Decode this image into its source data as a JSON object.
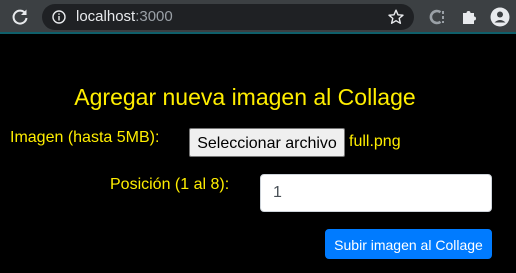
{
  "browser": {
    "url_host": "localhost",
    "url_port": ":3000",
    "icons": {
      "reload": "reload-icon",
      "info": "info-icon",
      "bookmark": "star-icon",
      "extension_1": "extension-c-icon",
      "extension_2": "puzzle-icon",
      "profile": "profile-icon"
    }
  },
  "form": {
    "title": "Agregar nueva imagen al Collage",
    "image_label": "Imagen (hasta 5MB):",
    "file_button_label": "Seleccionar archivo",
    "file_name": "full.png",
    "position_label": "Posición (1 al 8):",
    "position_value": "1",
    "submit_label": "Subir imagen al Collage"
  },
  "colors": {
    "page_background": "#000000",
    "text_accent": "#ffee00",
    "primary_button": "#007bff",
    "browser_bar": "#3c4043"
  }
}
